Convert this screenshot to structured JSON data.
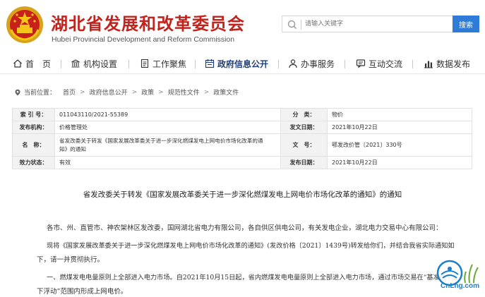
{
  "header": {
    "title": "湖北省发展和改革委员会",
    "subtitle": "Hubei Provincial Development and Reform Commission",
    "search_placeholder": "请输入关键字",
    "search_button": "搜索"
  },
  "nav": {
    "items": [
      {
        "label": "首　页",
        "icon": "home-icon"
      },
      {
        "label": "机构设置",
        "icon": "institution-icon"
      },
      {
        "label": "工作聚焦",
        "icon": "document-icon"
      },
      {
        "label": "政府信息公开",
        "icon": "calendar-icon"
      },
      {
        "label": "办事服务",
        "icon": "person-icon"
      },
      {
        "label": "互动交流",
        "icon": "chat-icon"
      },
      {
        "label": "数据发布",
        "icon": "bar-chart-icon"
      }
    ],
    "active_index": 3
  },
  "breadcrumb": {
    "prefix": "当前位置：",
    "items": [
      "首页",
      "政府信息公开",
      "政策",
      "规范性文件",
      "政策文件"
    ],
    "separator": ">"
  },
  "info": {
    "index_label": "索 引 号：",
    "index_value": "011043110/2021-55389",
    "category_label": "分　类：",
    "category_value": "物价",
    "publisher_label": "发布机构：",
    "publisher_value": "价格管理处",
    "issue_date_label": "发文日期：",
    "issue_date_value": "2021年10月22日",
    "name_label": "名　称：",
    "name_value_line1": "省发改委关于转发《国家发展改革委关于进一步深化燃煤发电上网电价市场化改革的通",
    "name_value_line2": "知》的通知",
    "docno_label": "文　号：",
    "docno_value": "鄂发改价管〔2021〕330号",
    "status_label": "效力状态：",
    "status_value": "有效",
    "publish_date_label": "发布日期：",
    "publish_date_value": "2021年10月22日"
  },
  "article": {
    "title": "省发改委关于转发《国家发展改革委关于进一步深化燃煤发电上网电价市场化改革的通知》的通知",
    "p1": "各市、州、直管市、神农架林区发改委，国网湖北省电力有限公司，各自供区供电公司，有关发电企业，湖北电力交易中心有限公司：",
    "p2a": "现将《国家发展改革委关于进一步深化燃煤发电上网电价市场化改革的通知》(发改价格〔2021〕1439号)转发给你们，并结合我省实际通知如",
    "p2b": "下，请一并贯彻执行。",
    "p3a": "一、燃煤发电电量原则上全部进入电力市场。自2021年10月15日起，省内燃煤发电电量原则上全部进入电力市场，通过市场交易在“基准价+上",
    "p3b": "下浮动”范围内形成上网电价。"
  },
  "watermark": {
    "text": "CnLng.com"
  },
  "colors": {
    "title_red": "#c0241d",
    "nav_active": "#1f3f7a",
    "search_button_blue": "#2f7cd8"
  }
}
